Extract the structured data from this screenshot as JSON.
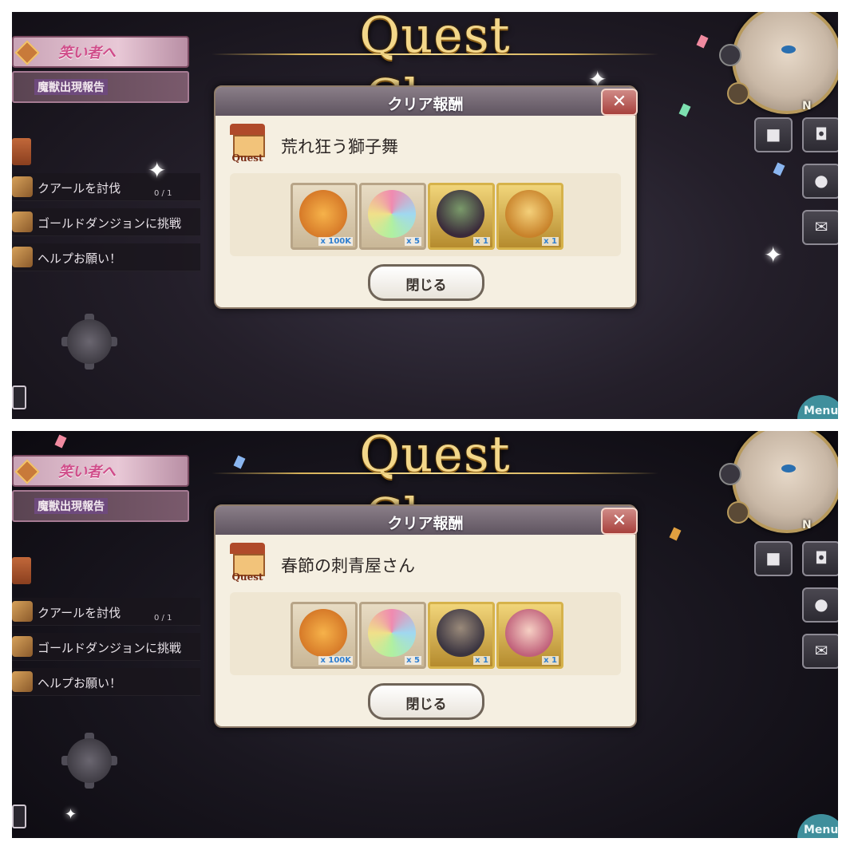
{
  "panels": [
    {
      "banner_title": "Quest Clear",
      "hud": {
        "event_banner": "笑い者へ",
        "notice": "魔獣出現報告",
        "quests": [
          {
            "label": "クアールを討伐",
            "progress": "0 / 1"
          },
          {
            "label": "ゴールドダンジョンに挑戦",
            "progress": ""
          },
          {
            "label": "ヘルプお願い！",
            "progress": ""
          }
        ]
      },
      "dialog": {
        "title": "クリア報酬",
        "close_symbol": "✕",
        "quest_badge_label": "Quest",
        "quest_name": "荒れ狂う獅子舞",
        "rewards": [
          {
            "icon": "gold-coin-icon",
            "qty": "x 100K"
          },
          {
            "icon": "rainbow-crystal-icon",
            "qty": "x 5"
          },
          {
            "icon": "green-demon-character-icon",
            "qty": "x 1"
          },
          {
            "icon": "lion-dancer-character-icon",
            "qty": "x 1"
          }
        ],
        "close_button": "閉じる"
      },
      "right_hud": {
        "compass_n": "N",
        "menu": "Menu"
      }
    },
    {
      "banner_title": "Quest Clear",
      "hud": {
        "event_banner": "笑い者へ",
        "notice": "魔獣出現報告",
        "quests": [
          {
            "label": "クアールを討伐",
            "progress": "0 / 1"
          },
          {
            "label": "ゴールドダンジョンに挑戦",
            "progress": ""
          },
          {
            "label": "ヘルプお願い！",
            "progress": ""
          }
        ]
      },
      "dialog": {
        "title": "クリア報酬",
        "close_symbol": "✕",
        "quest_badge_label": "Quest",
        "quest_name": "春節の刺青屋さん",
        "rewards": [
          {
            "icon": "gold-coin-icon",
            "qty": "x 100K"
          },
          {
            "icon": "rainbow-crystal-icon",
            "qty": "x 5"
          },
          {
            "icon": "armored-beast-character-icon",
            "qty": "x 1"
          },
          {
            "icon": "pink-hair-girl-character-icon",
            "qty": "x 1"
          }
        ],
        "close_button": "閉じる"
      },
      "right_hud": {
        "compass_n": "N",
        "menu": "Menu"
      }
    }
  ]
}
